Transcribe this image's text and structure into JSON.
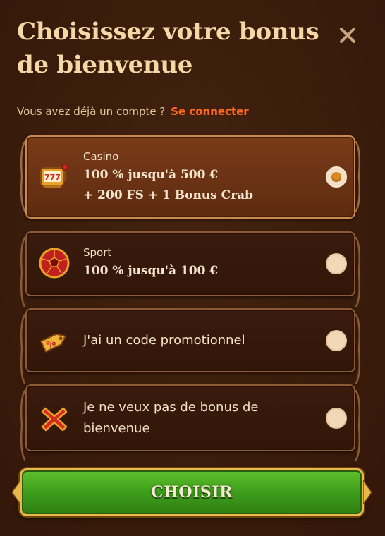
{
  "modal": {
    "title": "Choisissez votre bonus de bienvenue",
    "close_icon": "close-icon"
  },
  "login": {
    "prompt": "Vous avez déjà un compte ?",
    "link": "Se connecter"
  },
  "options": [
    {
      "id": "casino",
      "icon": "slot-machine-icon",
      "category": "Casino",
      "line1": "100 % jusqu'à 500 €",
      "line2": "+ 200 FS + 1 Bonus Crab",
      "selected": true
    },
    {
      "id": "sport",
      "icon": "soccer-ball-icon",
      "category": "Sport",
      "line1": "100 % jusqu'à 100 €",
      "selected": false
    },
    {
      "id": "promo",
      "icon": "promo-tag-icon",
      "label": "J'ai un code promotionnel",
      "selected": false
    },
    {
      "id": "none",
      "icon": "red-cross-icon",
      "line1": "Je ne veux pas de bonus de",
      "line2": "bienvenue",
      "selected": false
    }
  ],
  "cta": {
    "label": "CHOISIR"
  },
  "colors": {
    "background": "#3a1c0c",
    "title": "#f6d8a6",
    "link": "#ff6a1f",
    "selected_option": "#6a3214",
    "cta_green": "#3e9e1b",
    "cta_border": "#e9b94a",
    "radio_dot": "#d9891f"
  }
}
